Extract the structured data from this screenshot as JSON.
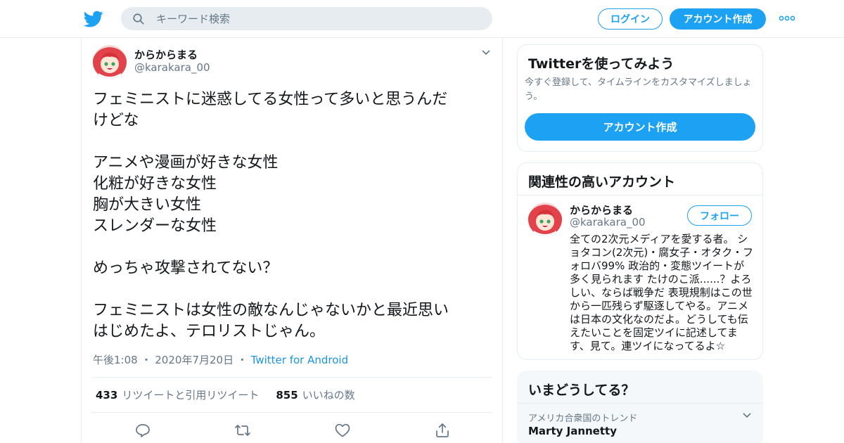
{
  "header": {
    "search_placeholder": "キーワード検索",
    "login_label": "ログイン",
    "signup_label": "アカウント作成"
  },
  "tweet": {
    "author_name": "からからまる",
    "author_handle": "@karakara_00",
    "lines": [
      "フェミニストに迷惑してる女性って多いと思うんだ",
      "けどな",
      "",
      "アニメや漫画が好きな女性",
      "化粧が好きな女性",
      "胸が大きい女性",
      "スレンダーな女性",
      "",
      "めっちゃ攻撃されてない？",
      "",
      "フェミニストは女性の敵なんじゃないかと最近思い",
      "はじめたよ、テロリストじゃん。"
    ],
    "time": "午後1:08",
    "date": "2020年7月20日",
    "source": "Twitter for Android",
    "retweets_count": "433",
    "retweets_label": "リツイートと引用リツイート",
    "likes_count": "855",
    "likes_label": "いいねの数"
  },
  "try_card": {
    "title": "Twitterを使ってみよう",
    "description": "今すぐ登録して、タイムラインをカスタマイズしましょう。",
    "button_label": "アカウント作成"
  },
  "related_card": {
    "title": "関連性の高いアカウント",
    "name": "からからまる",
    "handle": "@karakara_00",
    "follow_label": "フォロー",
    "bio": "全ての2次元メディアを愛する者。 ショタコン(2次元)・腐女子・オタク・フォロバ99% 政治的・変態ツイートが多く見られます たけのこ派......？よろしい、ならば戦争だ 表現規制はこの世から一匹残らず駆逐してやる。アニメは日本の文化なのだよ。どうしても伝えたいことを固定ツイに記述してます、見て。連ツイになってるよ☆"
  },
  "trends_card": {
    "title": "いまどうしてる？",
    "trend_label": "アメリカ合衆国のトレンド",
    "trend_name": "Marty Jannetty"
  },
  "colors": {
    "accent": "#1da1f2",
    "secondary_text": "#657786",
    "border": "#e6ecf0"
  },
  "icons": [
    "twitter-bird-icon",
    "search-icon",
    "more-dots-icon",
    "chevron-down-icon",
    "reply-icon",
    "retweet-icon",
    "like-heart-icon",
    "share-icon"
  ]
}
